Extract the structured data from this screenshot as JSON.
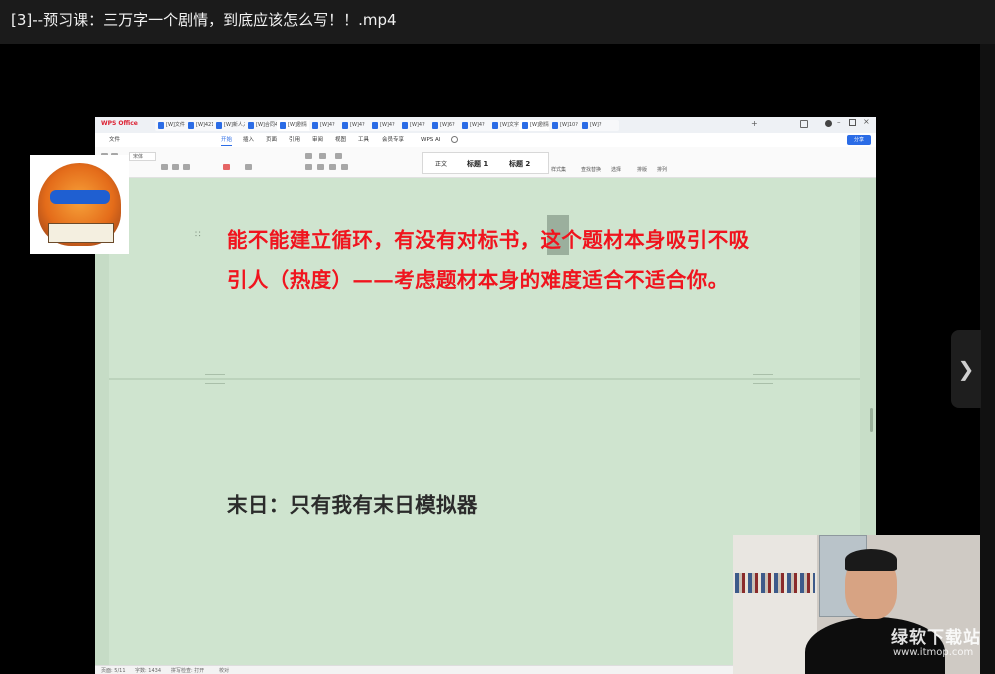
{
  "player": {
    "title": "[3]--预习课：三万字一个剧情，到底应该怎么写！！.mp4",
    "next_icon": "chevron-right-icon"
  },
  "wps": {
    "logo": "WPS Office",
    "tabs": [
      "[W]文件",
      "[W]421",
      "[W]新人入门",
      "[W]合同4?",
      "[W]剧情",
      "[W]4?",
      "[W]4?",
      "[W]4?",
      "[W]4?",
      "[W]6?",
      "[W]4?",
      "[W]文字1",
      "[W]剧情1",
      "[W]10?",
      "[W]?"
    ],
    "menus": [
      "文件",
      "开始",
      "插入",
      "页面",
      "引用",
      "审阅",
      "视图",
      "工具",
      "会员专享",
      "WPS AI"
    ],
    "active_menu": "开始",
    "share": "分享",
    "font_name": "宋体",
    "styles": [
      "正文",
      "标题 1",
      "标题 2"
    ],
    "ribbon_labels": [
      "样式集",
      "查找替换",
      "选择",
      "排版",
      "排列"
    ]
  },
  "document": {
    "red_paragraph": "能不能建立循环，有没有对标书，这个题材本身吸引不吸引人（热度）——考虑题材本身的难度适合不适合你。",
    "black_paragraph": "末日：只有我有末日模拟器"
  },
  "status": {
    "page": "页面: 5/11",
    "words": "字数: 1434",
    "spell": "拼写检查: 打开",
    "proof": "校对"
  },
  "watermark": {
    "brand": "绿软下载站",
    "url": "www.itmop.com"
  },
  "colors": {
    "doc_bg": "#cfe4cf",
    "red_text": "#f0141e",
    "accent": "#2b6ce6"
  }
}
